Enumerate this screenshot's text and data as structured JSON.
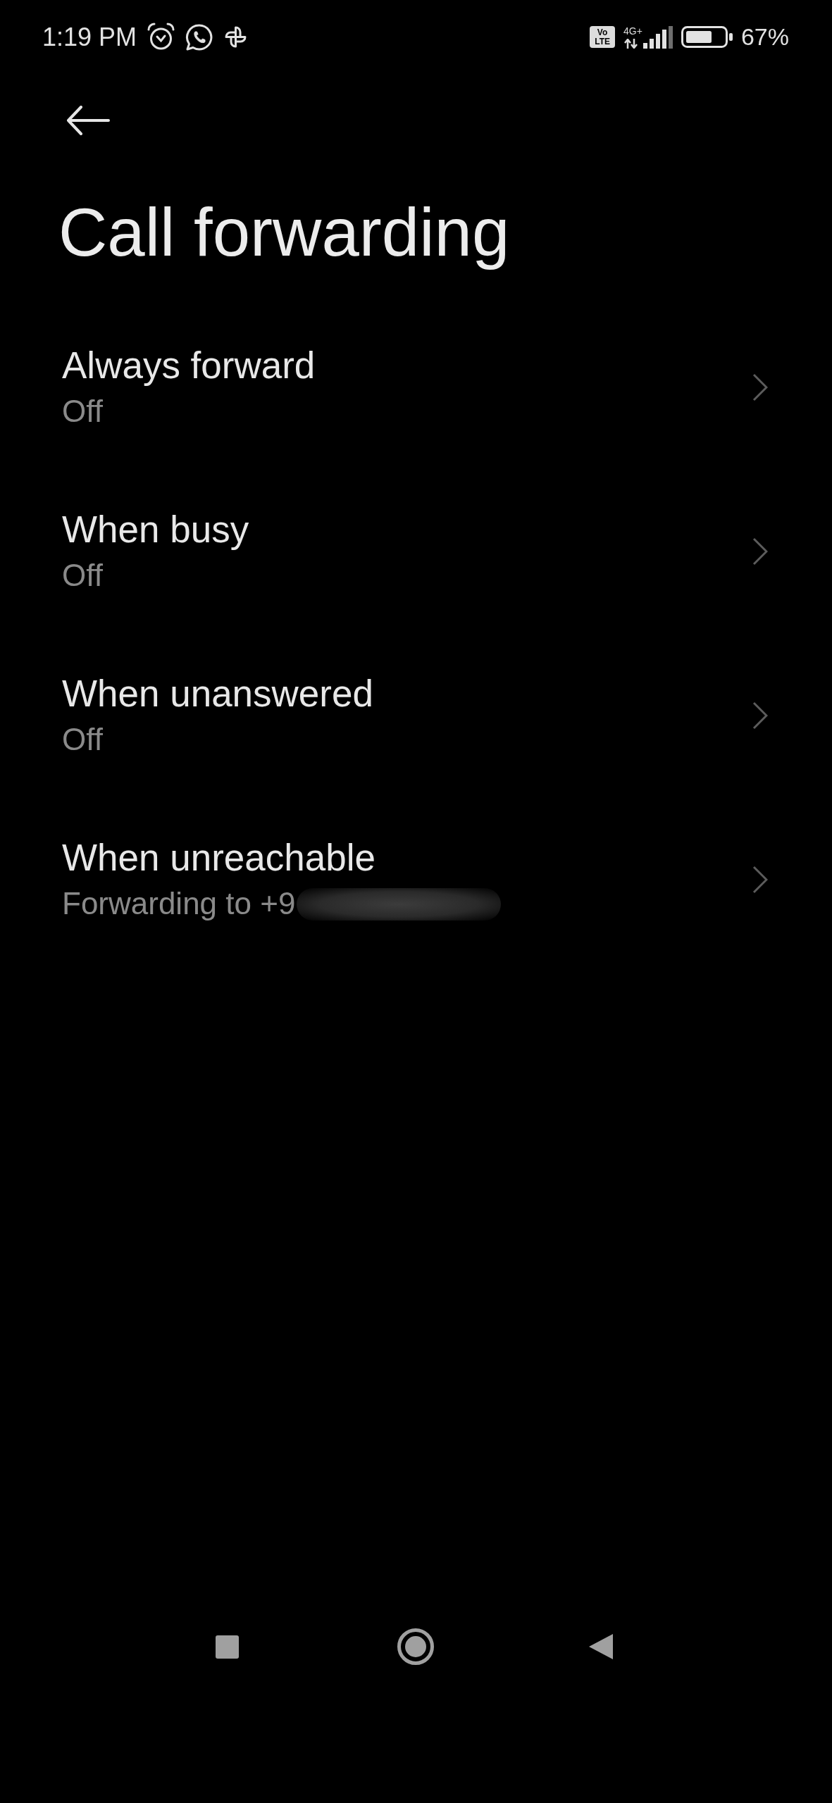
{
  "status_bar": {
    "time": "1:19 PM",
    "volte": [
      "Vo",
      "LTE"
    ],
    "network_type": "4G+",
    "battery": "67%"
  },
  "header": {
    "title": "Call forwarding"
  },
  "options": [
    {
      "title": "Always forward",
      "subtitle": "Off",
      "redacted": false
    },
    {
      "title": "When busy",
      "subtitle": "Off",
      "redacted": false
    },
    {
      "title": "When unanswered",
      "subtitle": "Off",
      "redacted": false
    },
    {
      "title": "When unreachable",
      "subtitle": "Forwarding to +9",
      "redacted": true
    }
  ]
}
